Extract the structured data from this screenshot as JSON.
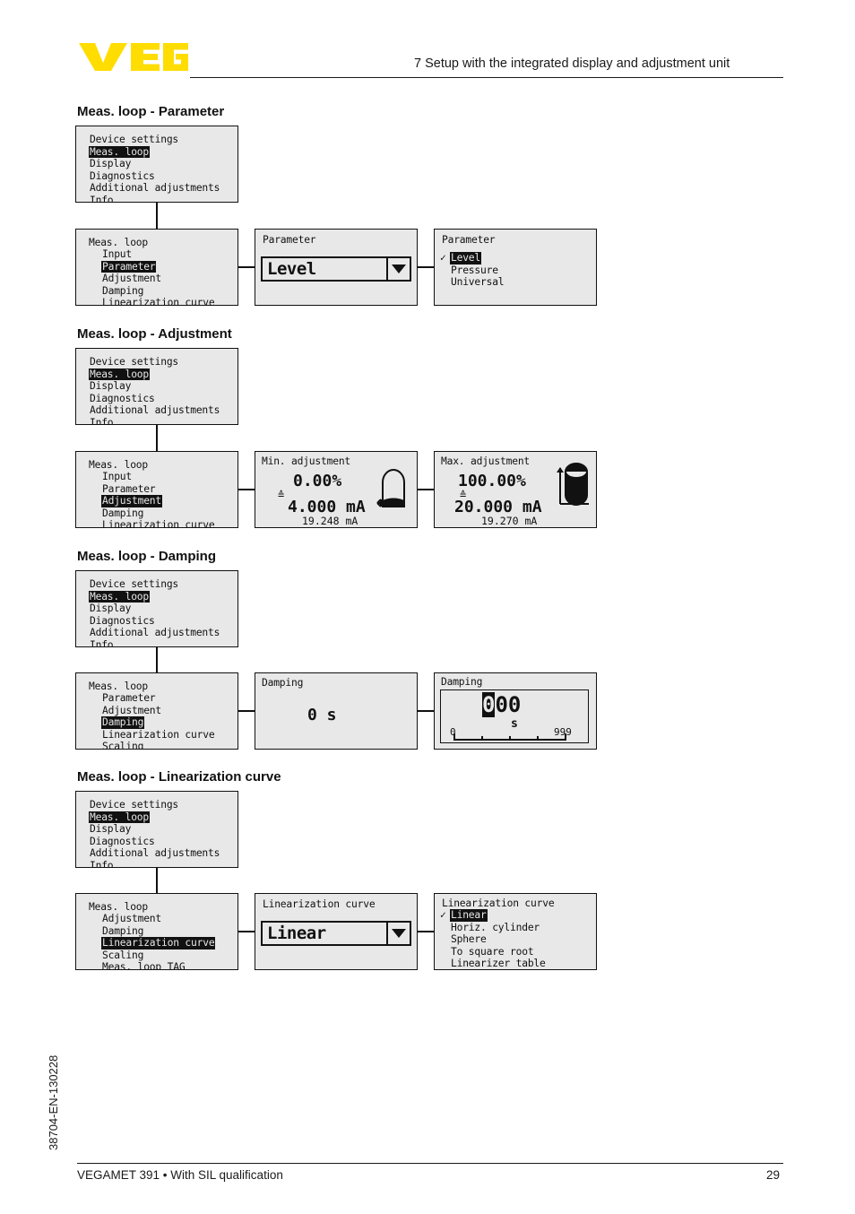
{
  "header": {
    "logo_text": "VEGA",
    "logo_color": "#ffdd00",
    "title": "7 Setup with the integrated display and adjustment unit"
  },
  "footer": {
    "left": "VEGAMET 391 • With SIL qualification",
    "page_number": "29",
    "side_code": "38704-EN-130228"
  },
  "sections": [
    {
      "heading": "Meas. loop - Parameter",
      "menu_main": {
        "items": [
          {
            "label": "Device settings",
            "selected": false
          },
          {
            "label": "Meas. loop",
            "selected": true
          },
          {
            "label": "Display",
            "selected": false
          },
          {
            "label": "Diagnostics",
            "selected": false
          },
          {
            "label": "Additional adjustments",
            "selected": false
          },
          {
            "label": "Info",
            "selected": false
          }
        ]
      },
      "menu_sub": {
        "title": "Meas. loop",
        "items": [
          {
            "label": "Input",
            "selected": false
          },
          {
            "label": "Parameter",
            "selected": true
          },
          {
            "label": "Adjustment",
            "selected": false
          },
          {
            "label": "Damping",
            "selected": false
          },
          {
            "label": "Linearization curve",
            "selected": false
          }
        ],
        "more": true
      },
      "screen_value": {
        "title": "Parameter",
        "value": "Level"
      },
      "screen_options": {
        "title": "Parameter",
        "options": [
          {
            "label": "Level",
            "checked": true,
            "selected": true
          },
          {
            "label": "Pressure",
            "checked": false,
            "selected": false
          },
          {
            "label": "Universal",
            "checked": false,
            "selected": false
          }
        ]
      }
    },
    {
      "heading": "Meas. loop - Adjustment",
      "menu_main": {
        "items": [
          {
            "label": "Device settings",
            "selected": false
          },
          {
            "label": "Meas. loop",
            "selected": true
          },
          {
            "label": "Display",
            "selected": false
          },
          {
            "label": "Diagnostics",
            "selected": false
          },
          {
            "label": "Additional adjustments",
            "selected": false
          },
          {
            "label": "Info",
            "selected": false
          }
        ]
      },
      "menu_sub": {
        "title": "Meas. loop",
        "items": [
          {
            "label": "Input",
            "selected": false
          },
          {
            "label": "Parameter",
            "selected": false
          },
          {
            "label": "Adjustment",
            "selected": true
          },
          {
            "label": "Damping",
            "selected": false
          },
          {
            "label": "Linearization curve",
            "selected": false
          }
        ],
        "more": true
      },
      "screen_min": {
        "title": "Min. adjustment",
        "percent": "0.00%",
        "equiv_symbol": "≙",
        "current": "4.000 mA",
        "measured": "19.248 mA",
        "tank_fill": "empty"
      },
      "screen_max": {
        "title": "Max. adjustment",
        "percent": "100.00%",
        "equiv_symbol": "≙",
        "current": "20.000 mA",
        "measured": "19.270 mA",
        "tank_fill": "full"
      }
    },
    {
      "heading": "Meas. loop - Damping",
      "menu_main": {
        "items": [
          {
            "label": "Device settings",
            "selected": false
          },
          {
            "label": "Meas. loop",
            "selected": true
          },
          {
            "label": "Display",
            "selected": false
          },
          {
            "label": "Diagnostics",
            "selected": false
          },
          {
            "label": "Additional adjustments",
            "selected": false
          },
          {
            "label": "Info",
            "selected": false
          }
        ]
      },
      "menu_sub": {
        "title": "Meas. loop",
        "items": [
          {
            "label": "Parameter",
            "selected": false
          },
          {
            "label": "Adjustment",
            "selected": false
          },
          {
            "label": "Damping",
            "selected": true
          },
          {
            "label": "Linearization curve",
            "selected": false
          },
          {
            "label": "Scaling",
            "selected": false
          }
        ],
        "more": true
      },
      "screen_value": {
        "title": "Damping",
        "value": "0 s"
      },
      "screen_editor": {
        "title": "Damping",
        "digits": "000",
        "active_digit_index": 0,
        "unit": "s",
        "scale_min": "0",
        "scale_max": "999"
      }
    },
    {
      "heading": "Meas. loop - Linearization curve",
      "menu_main": {
        "items": [
          {
            "label": "Device settings",
            "selected": false
          },
          {
            "label": "Meas. loop",
            "selected": true
          },
          {
            "label": "Display",
            "selected": false
          },
          {
            "label": "Diagnostics",
            "selected": false
          },
          {
            "label": "Additional adjustments",
            "selected": false
          },
          {
            "label": "Info",
            "selected": false
          }
        ]
      },
      "menu_sub": {
        "title": "Meas. loop",
        "items": [
          {
            "label": "Adjustment",
            "selected": false
          },
          {
            "label": "Damping",
            "selected": false
          },
          {
            "label": "Linearization curve",
            "selected": true
          },
          {
            "label": "Scaling",
            "selected": false
          },
          {
            "label": "Meas. loop TAG",
            "selected": false
          }
        ],
        "more": true
      },
      "screen_value": {
        "title": "Linearization curve",
        "value": "Linear"
      },
      "screen_options": {
        "title": "Linearization curve",
        "options": [
          {
            "label": "Linear",
            "checked": true,
            "selected": true
          },
          {
            "label": "Horiz. cylinder",
            "checked": false,
            "selected": false
          },
          {
            "label": "Sphere",
            "checked": false,
            "selected": false
          },
          {
            "label": "To square root",
            "checked": false,
            "selected": false
          },
          {
            "label": "Linearizer table",
            "checked": false,
            "selected": false
          }
        ]
      }
    }
  ]
}
